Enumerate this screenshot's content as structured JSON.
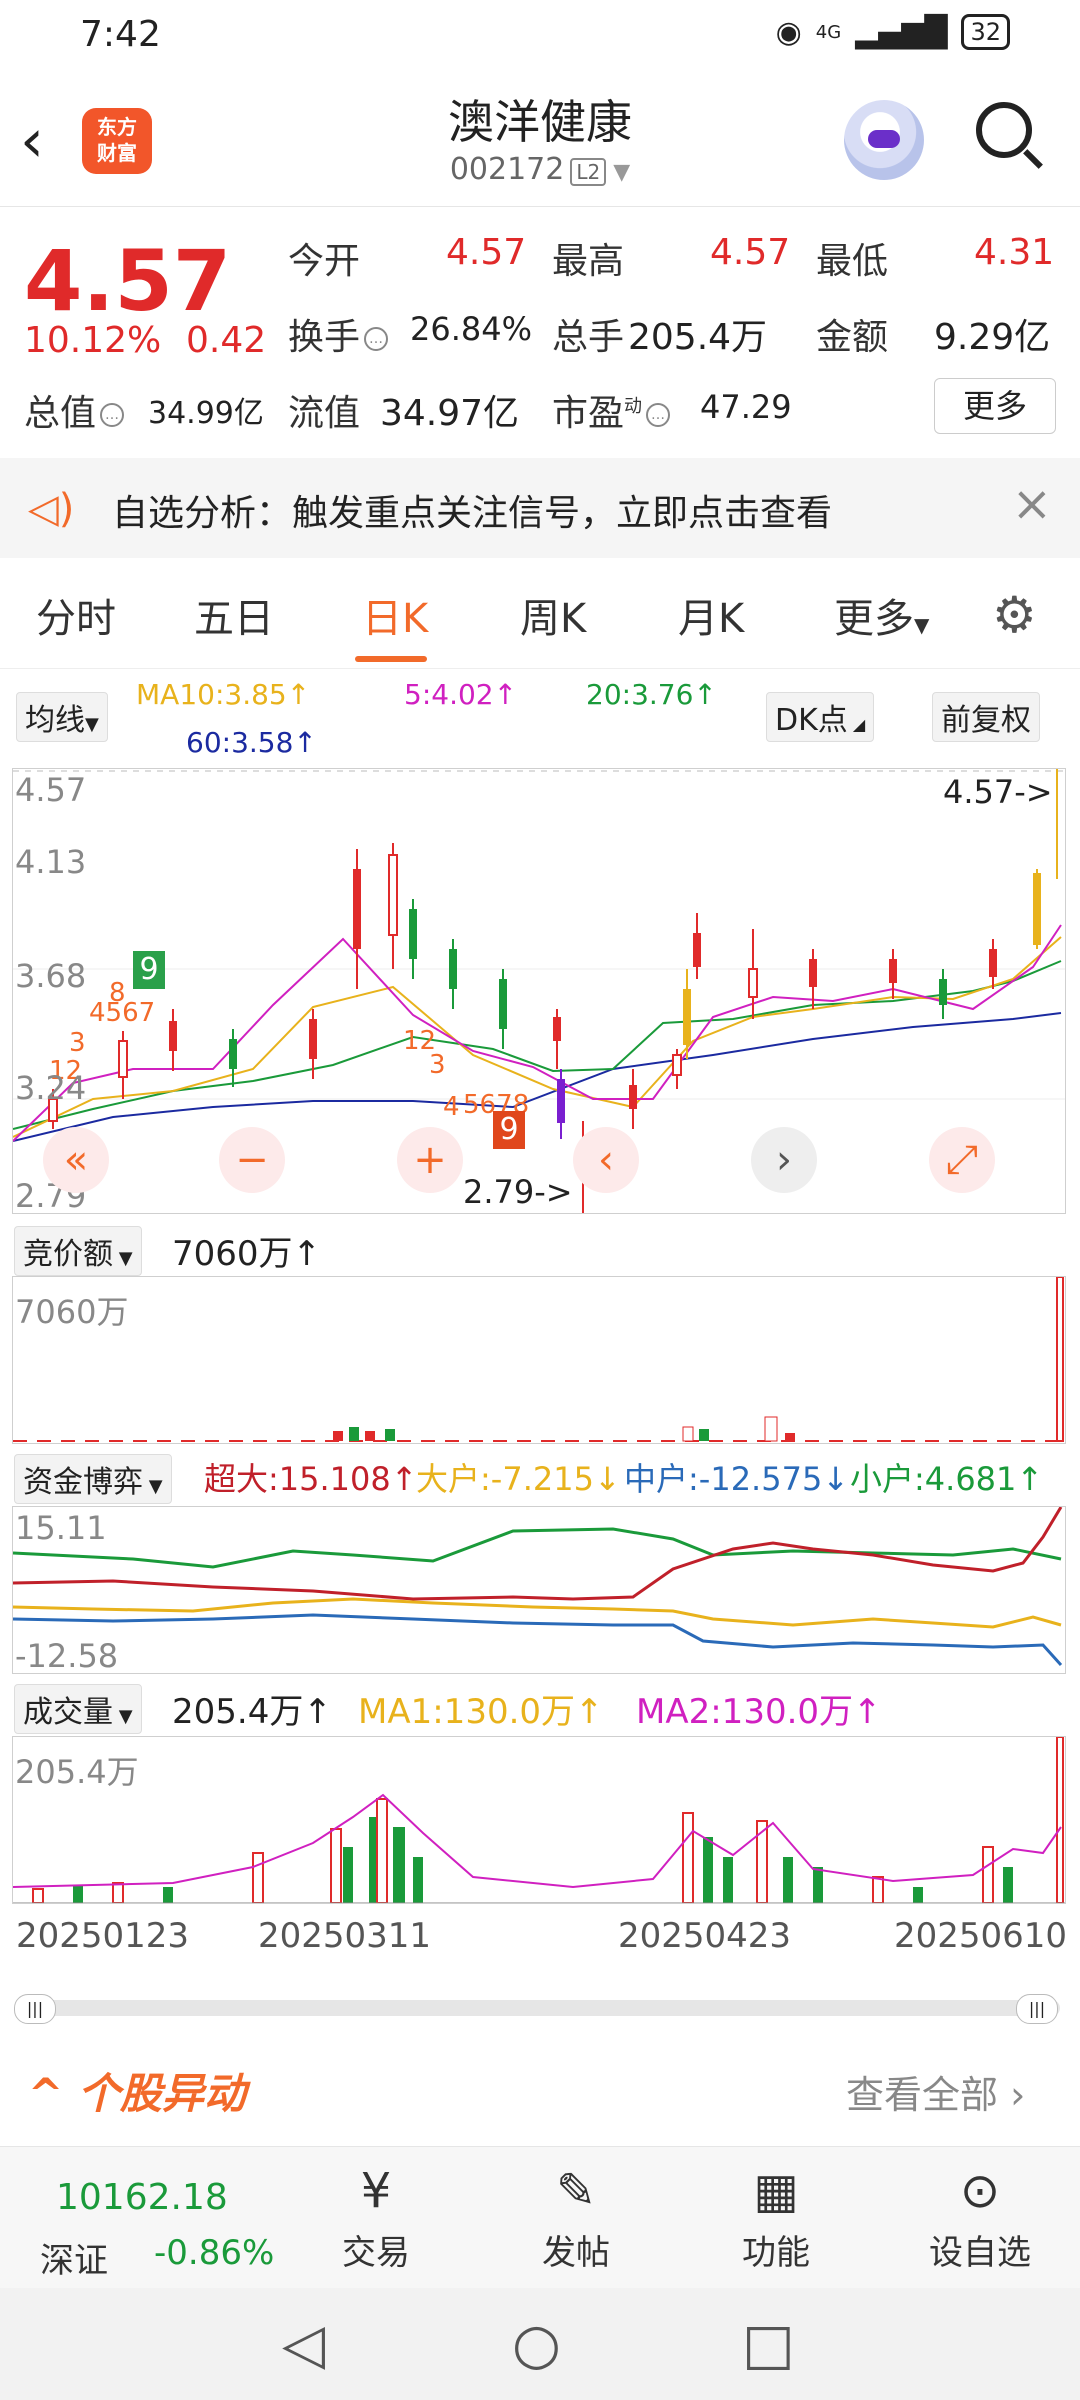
{
  "status": {
    "time": "7:42",
    "net": "4G",
    "battery": "32"
  },
  "header": {
    "title": "澳洋健康",
    "code": "002172",
    "level": "L2",
    "logo_line1": "东方",
    "logo_line2": "财富"
  },
  "quote": {
    "price": "4.57",
    "pct": "10.12%",
    "chg": "0.42",
    "open_label": "今开",
    "open": "4.57",
    "high_label": "最高",
    "high": "4.57",
    "low_label": "最低",
    "low": "4.31",
    "turnover_label": "换手",
    "turnover": "26.84%",
    "vol_label": "总手",
    "vol": "205.4万",
    "amount_label": "金额",
    "amount": "9.29亿",
    "mktcap_label": "总值",
    "mktcap": "34.99亿",
    "float_label": "流值",
    "float": "34.97亿",
    "pe_label": "市盈",
    "pe_sup": "动",
    "pe": "47.29",
    "more": "更多"
  },
  "notice": {
    "text": "自选分析：触发重点关注信号，立即点击查看"
  },
  "tabs": [
    "分时",
    "五日",
    "日K",
    "周K",
    "月K",
    "更多"
  ],
  "ma": {
    "selector": "均线",
    "ma10": "MA10:3.85↑",
    "ma5": "5:4.02↑",
    "ma20": "20:3.76↑",
    "ma60": "60:3.58↑",
    "dk": "DK点",
    "adjust": "前复权"
  },
  "kline": {
    "y_top": "4.57",
    "y2": "4.13",
    "y3": "3.68",
    "y4": "3.24",
    "y_bottom": "2.79",
    "high_marker": "4.57->",
    "low_marker": "2.79->",
    "signal_a": "9",
    "signal_b": "9"
  },
  "auction": {
    "selector": "竞价额",
    "value": "7060万↑",
    "axis": "7060万"
  },
  "funds": {
    "selector": "资金博弈",
    "super": "超大:15.108↑",
    "large": "大户:-7.215↓",
    "mid": "中户:-12.575↓",
    "small": "小户:4.681↑",
    "y_top": "15.11",
    "y_bottom": "-12.58"
  },
  "volume": {
    "selector": "成交量",
    "value": "205.4万↑",
    "ma1": "MA1:130.0万↑",
    "ma2": "MA2:130.0万↑",
    "axis": "205.4万"
  },
  "dates": [
    "20250123",
    "20250311",
    "20250423",
    "20250610"
  ],
  "section": {
    "title": "个股异动",
    "link": "查看全部"
  },
  "bottom": {
    "index_value": "10162.18",
    "index_name": "深证",
    "index_chg": "-0.86%",
    "items": [
      "交易",
      "发帖",
      "功能",
      "设自选"
    ]
  },
  "colors": {
    "up": "#e02a2a",
    "down": "#1a9a3a",
    "accent": "#f26a2a",
    "ma10": "#e8b21c",
    "ma5": "#d020c0",
    "ma20": "#1a9a3a",
    "ma60": "#1b2aa0"
  }
}
